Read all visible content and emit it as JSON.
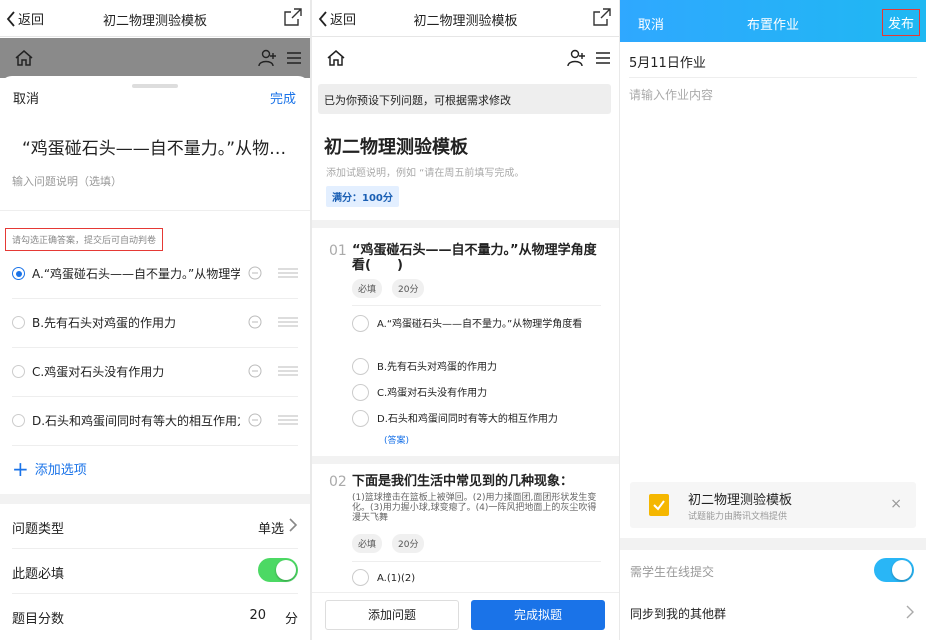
{
  "panel1": {
    "back_label": "返回",
    "title": "初二物理测验模板",
    "sheet_cancel": "取消",
    "sheet_done": "完成",
    "question_title": "“鸡蛋碰石头——自不量力。”从物理学角度看(　　)",
    "question_desc_placeholder": "输入问题说明（选填）",
    "hint": "请勾选正确答案，提交后可自动判卷",
    "options": [
      {
        "label": "A.“鸡蛋碰石头——自不量力。”从物理学角度看",
        "checked": true
      },
      {
        "label": "B.先有石头对鸡蛋的作用力",
        "checked": false
      },
      {
        "label": "C.鸡蛋对石头没有作用力",
        "checked": false
      },
      {
        "label": "D.石头和鸡蛋间同时有等大的相互作用力",
        "checked": false
      }
    ],
    "add_option": "添加选项",
    "settings": {
      "type_label": "问题类型",
      "type_value": "单选",
      "required_label": "此题必填",
      "required_on": true,
      "score_label": "题目分数",
      "score_value": "20",
      "score_unit": "分"
    }
  },
  "panel2": {
    "back_label": "返回",
    "title": "初二物理测验模板",
    "banner": "已为你预设下列问题，可根据需求修改",
    "form_title": "初二物理测验模板",
    "form_desc": "添加试题说明，例如 “请在周五前填写完成。",
    "score_badge": "满分：100分",
    "q1": {
      "num": "01",
      "text": "“鸡蛋碰石头——自不量力。”从物理学角度看(　　)",
      "tag_required": "必填",
      "tag_score": "20分",
      "options": [
        "A.“鸡蛋碰石头——自不量力。”从物理学角度看",
        "B.先有石头对鸡蛋的作用力",
        "C.鸡蛋对石头没有作用力",
        "D.石头和鸡蛋间同时有等大的相互作用力"
      ],
      "answer_mark": "(答案)"
    },
    "q2": {
      "num": "02",
      "text": "下面是我们生活中常见到的几种现象：",
      "desc": "(1)篮球撞击在篮板上被弹回。(2)用力揉面团,面团形状发生变化。(3)用力握小球,球变瘪了。(4)一阵风把地面上的灰尘吹得漫天飞舞",
      "tag_required": "必填",
      "tag_score": "20分",
      "first_option": "A.(1)(2)"
    },
    "btn_add_question": "添加问题",
    "btn_finish": "完成拟题"
  },
  "panel3": {
    "cancel": "取消",
    "title": "布置作业",
    "publish": "发布",
    "homework_title": "5月11日作业",
    "content_placeholder": "请输入作业内容",
    "attachment_title": "初二物理测验模板",
    "attachment_sub": "试题能力由腾讯文档提供",
    "attachment_close": "×",
    "online_submit_label": "需学生在线提交",
    "online_submit_on": true,
    "sync_label": "同步到我的其他群"
  },
  "colors": {
    "accent_blue": "#1a73e8",
    "toggle_green": "#4cd964",
    "toggle_blue": "#29b6f6",
    "highlight_red": "#e53935",
    "header_gradient_start": "#2fa8ff",
    "header_gradient_end": "#1fb8f2"
  },
  "icons": [
    "back-chevron-icon",
    "share-external-icon",
    "home-icon",
    "add-user-icon",
    "menu-icon",
    "remove-circle-icon",
    "drag-handle-icon",
    "plus-icon",
    "chevron-right-icon",
    "document-icon",
    "close-icon"
  ]
}
